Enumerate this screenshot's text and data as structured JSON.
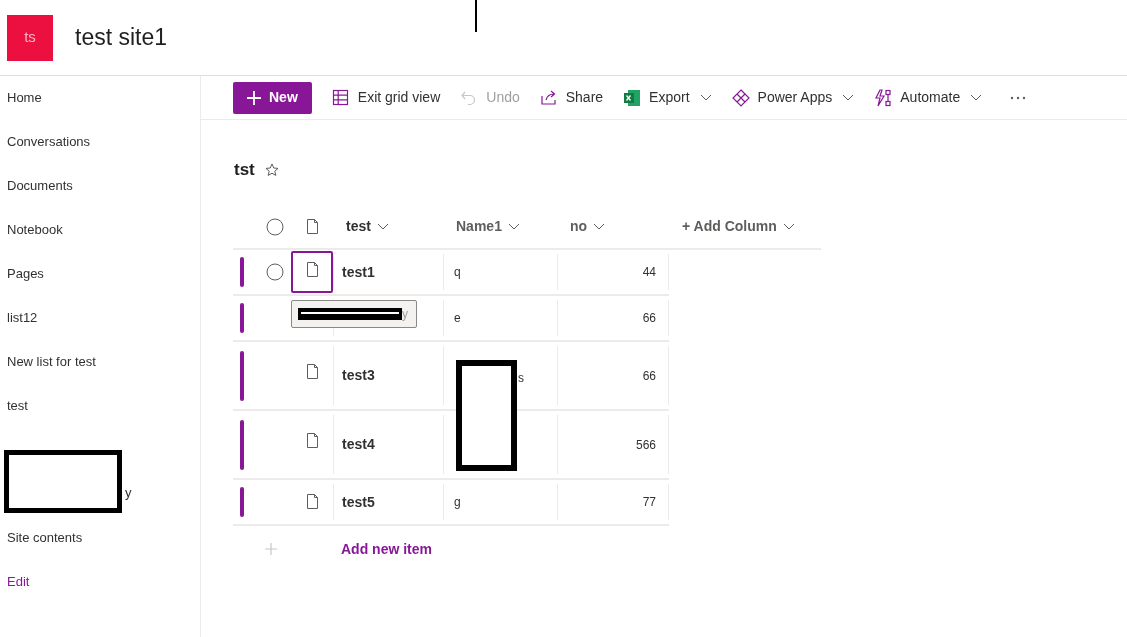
{
  "site": {
    "logo": "ts",
    "title": "test site1"
  },
  "nav": [
    {
      "label": "Home"
    },
    {
      "label": "Conversations"
    },
    {
      "label": "Documents"
    },
    {
      "label": "Notebook"
    },
    {
      "label": "Pages"
    },
    {
      "label": "list12"
    },
    {
      "label": "New list for test"
    },
    {
      "label": "test"
    },
    {
      "kind": "redacted",
      "tail": "y"
    },
    {
      "label": "Site contents"
    },
    {
      "label": "Edit",
      "kind": "link"
    }
  ],
  "commands": [
    {
      "label": "New",
      "kind": "primary"
    },
    {
      "label": "Exit grid view",
      "disabled": false,
      "dropdown": false
    },
    {
      "label": "Undo",
      "disabled": true,
      "dropdown": false
    },
    {
      "label": "Share",
      "disabled": false,
      "dropdown": false
    },
    {
      "label": "Export",
      "disabled": false,
      "dropdown": true
    },
    {
      "label": "Power Apps",
      "disabled": false,
      "dropdown": true
    },
    {
      "label": "Automate",
      "disabled": false,
      "dropdown": true
    },
    {
      "kind": "more"
    }
  ],
  "list": {
    "title": "tst",
    "favorite": false
  },
  "select_all": {
    "checked": false
  },
  "columns": [
    {
      "label": "test"
    },
    {
      "label": "Name1"
    },
    {
      "label": "no"
    },
    {
      "label": "+ Add Column"
    }
  ],
  "rows": [
    {
      "test": "test1",
      "name1": [
        "q"
      ],
      "no": "44",
      "focused": true,
      "selected": false,
      "tall": false
    },
    {
      "name1": [
        "e"
      ],
      "no": "66",
      "focused": false,
      "selected": false,
      "tall": false,
      "tooltip": {
        "tail": "y"
      }
    },
    {
      "test": "test3",
      "name1_tail": "s",
      "no": "66",
      "focused": false,
      "selected": false,
      "tall": true
    },
    {
      "test": "test4",
      "no": "566",
      "focused": false,
      "selected": false,
      "tall": true
    },
    {
      "test": "test5",
      "name1": [
        "g"
      ],
      "no": "77",
      "focused": false,
      "selected": false,
      "tall": false
    }
  ],
  "add_item": "Add new item"
}
